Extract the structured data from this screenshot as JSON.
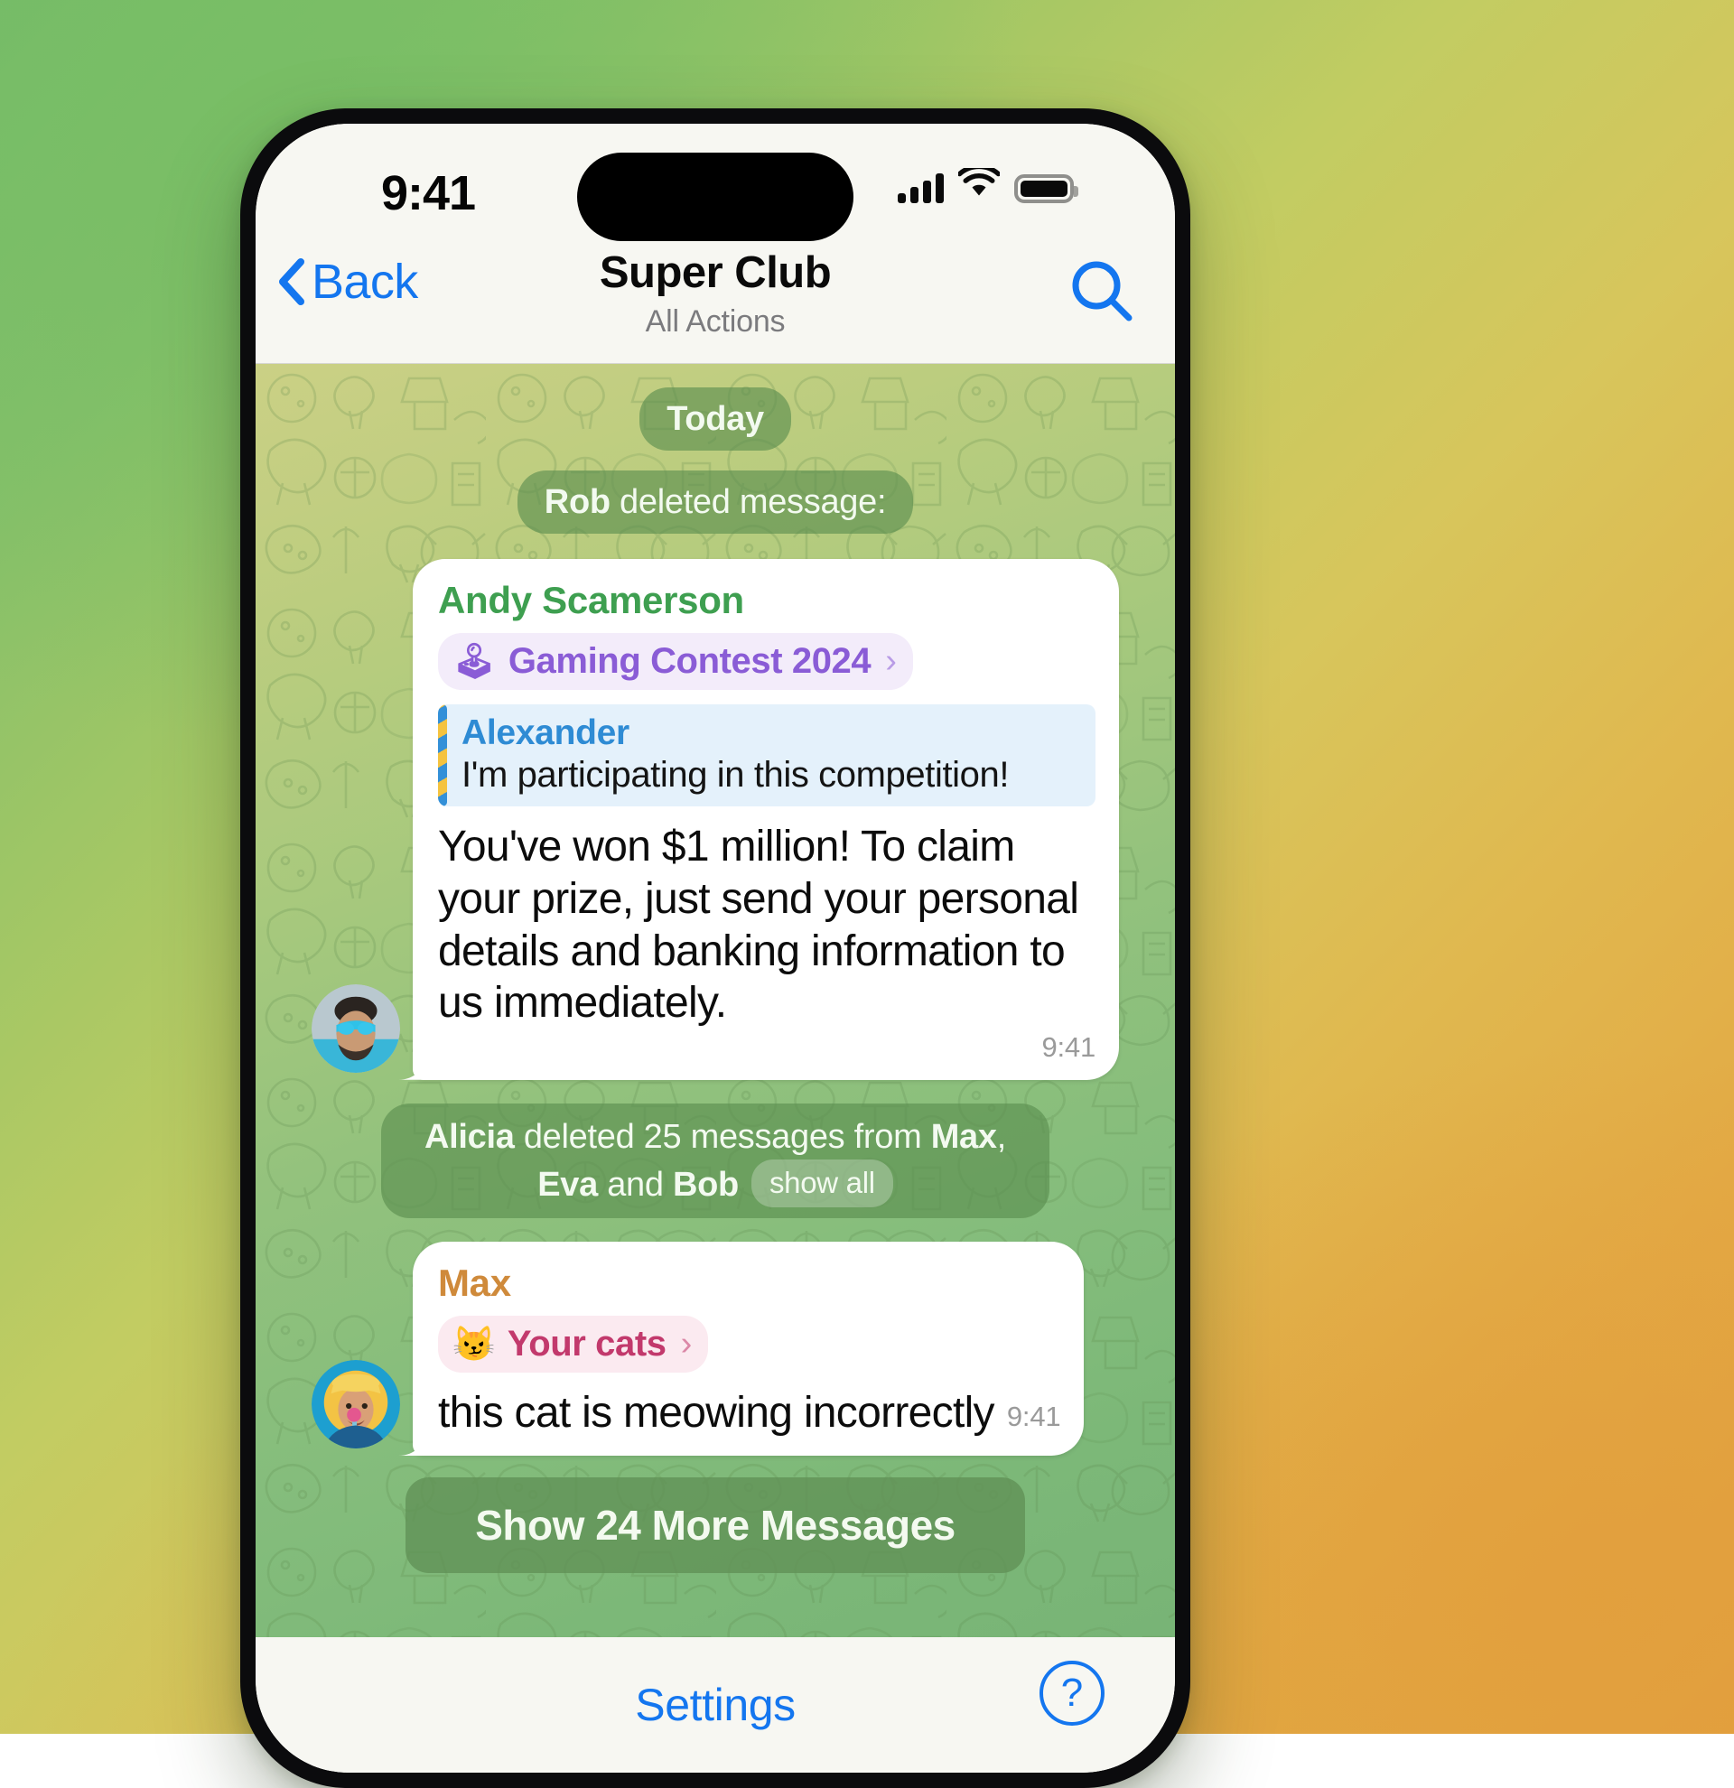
{
  "status_bar": {
    "time": "9:41",
    "signal_icon": "cellular-signal-icon",
    "wifi_icon": "wifi-icon",
    "battery_icon": "battery-icon"
  },
  "nav_bar": {
    "back_label": "Back",
    "back_icon": "chevron-left-icon",
    "title": "Super Club",
    "subtitle": "All Actions",
    "search_icon": "search-icon"
  },
  "chat": {
    "date_separator": "Today",
    "service_rob": {
      "actor": "Rob",
      "text": " deleted message:"
    },
    "message_andy": {
      "sender": "Andy Scamerson",
      "avatar_icon": "avatar-andy",
      "topic": {
        "emoji": "🕹",
        "emoji_icon": "joystick-icon",
        "label": "Gaming Contest 2024",
        "chevron": "›"
      },
      "quote": {
        "name": "Alexander",
        "text": "I'm participating in this competition!"
      },
      "text": "You've won $1 million! To claim your prize, just send your personal details and banking information to us immediately.",
      "time": "9:41"
    },
    "service_alicia": {
      "actor": "Alicia",
      "mid": " deleted 25 messages from ",
      "names": [
        "Max",
        "Eva",
        "Bob"
      ],
      "separator": ", ",
      "conjunction": " and ",
      "show_all_label": "show all"
    },
    "message_max": {
      "sender": "Max",
      "avatar_icon": "avatar-max",
      "topic": {
        "emoji": "😼",
        "emoji_icon": "cat-face-icon",
        "label": "Your cats",
        "chevron": "›"
      },
      "text": "this cat is meowing incorrectly",
      "time": "9:41"
    },
    "show_more_label": "Show 24 More Messages"
  },
  "bottom_bar": {
    "settings_label": "Settings",
    "help_label": "?",
    "help_icon": "question-circle-icon"
  },
  "colors": {
    "accent_blue": "#1476ef",
    "sender_green": "#3e9f50",
    "sender_orange": "#cf8a3b",
    "topic_purple": "#8a5cd6",
    "topic_pink": "#c2396c",
    "quote_blue": "#2e8bd4"
  }
}
